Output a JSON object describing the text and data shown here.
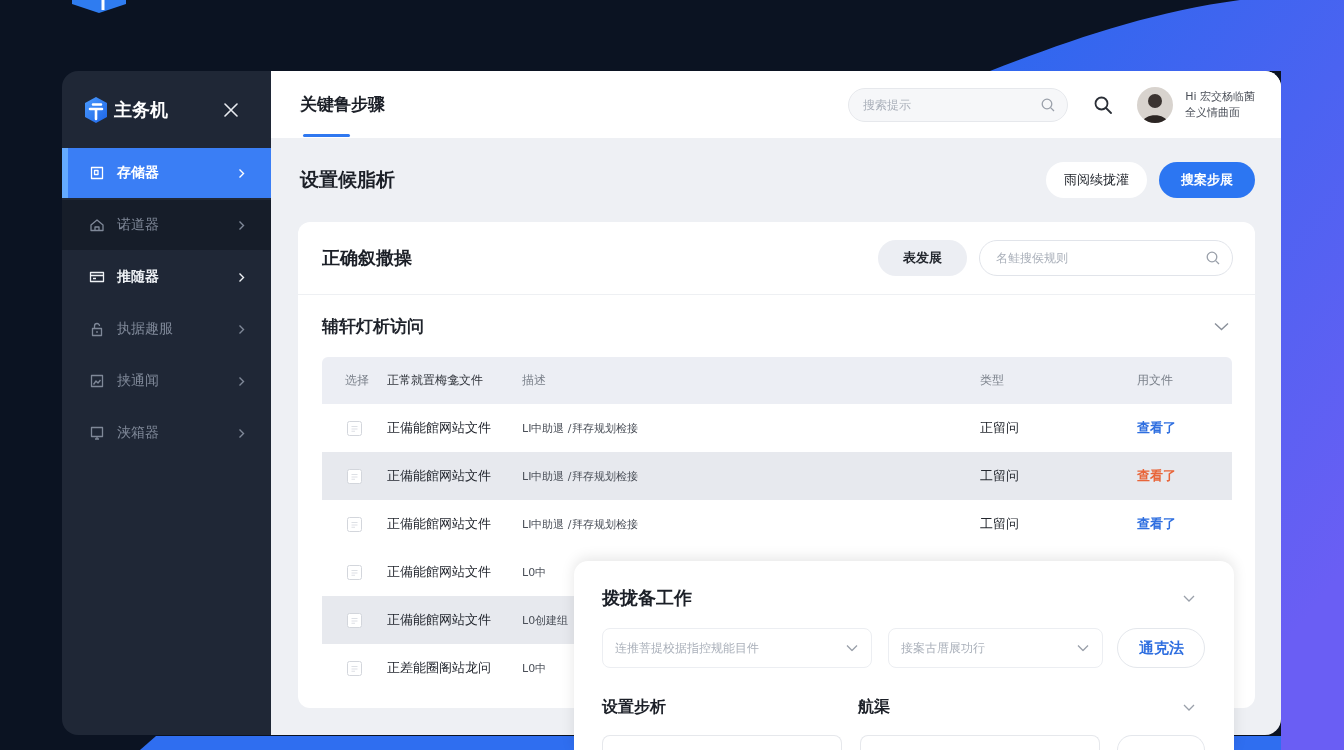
{
  "sidebar": {
    "brand": "主务机",
    "items": [
      {
        "label": "存储器",
        "selected": true,
        "hovered": false,
        "emphasized": false
      },
      {
        "label": "诺道器",
        "selected": false,
        "hovered": true,
        "emphasized": false
      },
      {
        "label": "推随器",
        "selected": false,
        "hovered": false,
        "emphasized": true
      },
      {
        "label": "执据趣服",
        "selected": false,
        "hovered": false,
        "emphasized": false
      },
      {
        "label": "挟通闻",
        "selected": false,
        "hovered": false,
        "emphasized": false
      },
      {
        "label": "浃箱器",
        "selected": false,
        "hovered": false,
        "emphasized": false
      }
    ]
  },
  "topbar": {
    "tabs": [
      {
        "label": "关键鲁步骤",
        "selected": true
      }
    ],
    "search": {
      "placeholder": "搜索提示"
    },
    "user": {
      "greeting": "Hi 宏交杨临菌",
      "subtitle": "全义情曲面"
    }
  },
  "page": {
    "title": "设置候脂析",
    "buttons": [
      {
        "label": "雨阅续拢灌",
        "kind": "secondary"
      },
      {
        "label": "搜案步展",
        "kind": "primary"
      }
    ]
  },
  "card": {
    "title": "正确叙撒操",
    "filter_button": "表发展",
    "search": {
      "placeholder": "名鲑搜侯规则"
    },
    "section_title": "辅轩灯析访问",
    "table": {
      "columns": [
        "选择",
        "正常就置梅龛文件",
        "描述",
        "类型",
        "用文件"
      ],
      "rows": [
        {
          "checked": false,
          "highlighted": false,
          "name": "正備能館网站文件",
          "description": "LI中助退 /拜存规划检接",
          "type": "正留问",
          "status": "查看了",
          "color": "#2f6fe0"
        },
        {
          "checked": false,
          "highlighted": true,
          "name": "正備能館网站文件",
          "description": "LI中助退 /拜存规划检接",
          "type": "工留问",
          "status": "查看了",
          "color": "#e8653a"
        },
        {
          "checked": false,
          "highlighted": false,
          "name": "正備能館网站文件",
          "description": "LI中助退 /拜存规划检接",
          "type": "工留问",
          "status": "查看了",
          "color": "#2f6fe0"
        },
        {
          "checked": false,
          "highlighted": false,
          "name": "正備能館网站文件",
          "description": "L0中"
        },
        {
          "checked": false,
          "highlighted": true,
          "name": "正備能館网站文件",
          "description": "L0创建组"
        },
        {
          "checked": false,
          "highlighted": false,
          "name": "正差能圈阁站龙问",
          "description": "L0中"
        }
      ]
    }
  },
  "panel": {
    "title": "拨拢备工作",
    "selects": [
      {
        "placeholder": "连推菩提校据指控规能目件"
      },
      {
        "placeholder": "接案古厝展功行"
      }
    ],
    "button": "通克法",
    "labels": [
      "设置步析",
      "航渠"
    ]
  }
}
